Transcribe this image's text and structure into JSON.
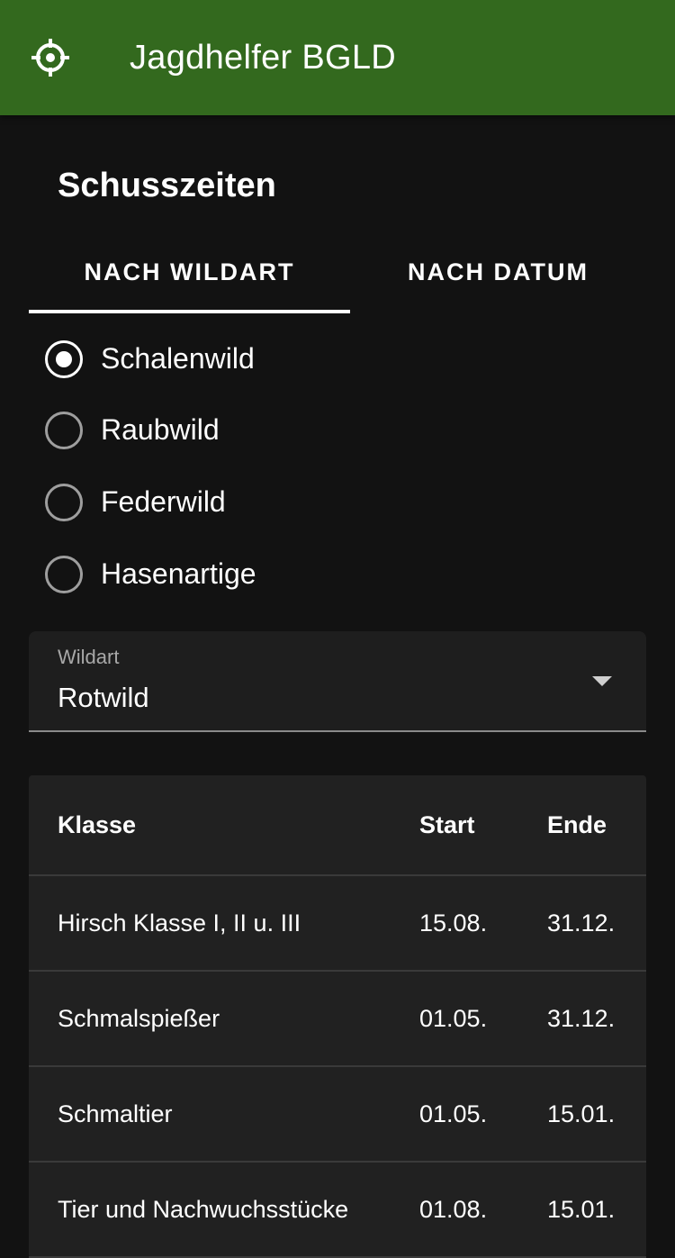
{
  "app_bar": {
    "icon": "crosshair-icon",
    "title": "Jagdhelfer BGLD",
    "color": "#33691e"
  },
  "page": {
    "heading": "Schusszeiten"
  },
  "tabs": [
    {
      "label": "NACH WILDART",
      "selected": true
    },
    {
      "label": "NACH DATUM",
      "selected": false
    }
  ],
  "categories": [
    {
      "label": "Schalenwild",
      "checked": true
    },
    {
      "label": "Raubwild",
      "checked": false
    },
    {
      "label": "Federwild",
      "checked": false
    },
    {
      "label": "Hasenartige",
      "checked": false
    }
  ],
  "wildart_select": {
    "label": "Wildart",
    "value": "Rotwild"
  },
  "table": {
    "headers": [
      "Klasse",
      "Start",
      "Ende"
    ],
    "rows": [
      [
        "Hirsch Klasse I, II u. III",
        "15.08.",
        "31.12."
      ],
      [
        "Schmalspießer",
        "01.05.",
        "31.12."
      ],
      [
        "Schmaltier",
        "01.05.",
        "15.01."
      ],
      [
        "Tier und Nachwuchsstücke",
        "01.08.",
        "15.01."
      ]
    ]
  }
}
